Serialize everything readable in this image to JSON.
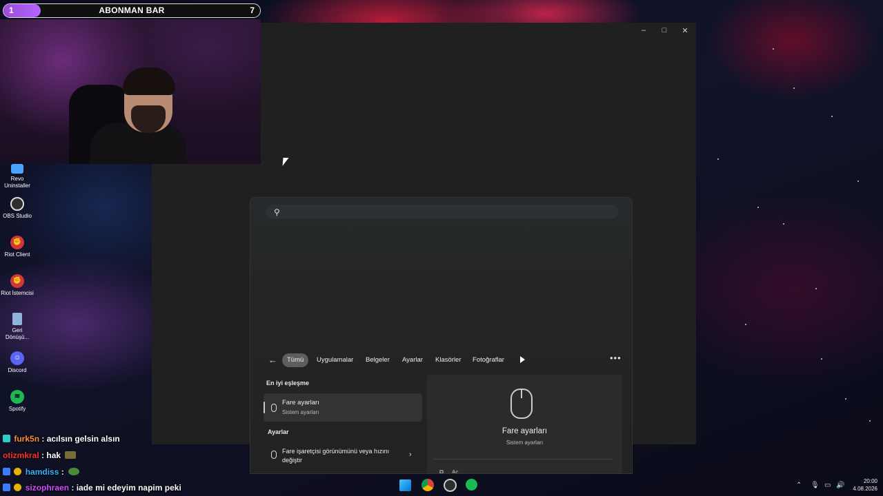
{
  "overlay": {
    "abonman_bar": {
      "left_value": "1",
      "title": "ABONMAN BAR",
      "right_value": "7",
      "progress_fraction": 0.14
    }
  },
  "window_controls": {
    "minimize": "–",
    "maximize": "□",
    "close": "✕"
  },
  "desktop_icons": [
    {
      "label": "Revo Uninstaller",
      "icon": "revo-uninstaller-icon",
      "color": "#4aa3ff"
    },
    {
      "label": "OBS Studio",
      "icon": "obs-studio-icon",
      "color": "#3a3a3a"
    },
    {
      "label": "Riot Client",
      "icon": "riot-client-icon",
      "color": "#d13639"
    },
    {
      "label": "Riot İstemcisi",
      "icon": "riot-client-icon",
      "color": "#d13639"
    },
    {
      "label": "Geri Dönüşü...",
      "icon": "recycle-bin-icon",
      "color": "#8fb3d9"
    },
    {
      "label": "Discord",
      "icon": "discord-icon",
      "color": "#5865f2"
    },
    {
      "label": "Spotify",
      "icon": "spotify-icon",
      "color": "#1db954"
    }
  ],
  "chat": [
    {
      "user": "furk5n",
      "message": ": acılsın gelsin alsın",
      "user_color": "#ff8c3a"
    },
    {
      "user": "otizmkral",
      "message": ": hak",
      "user_color": "#ff3030"
    },
    {
      "user": "hamdiss",
      "message": ":",
      "user_color": "#33b5ff"
    },
    {
      "user": "sizophraen",
      "message": ": iade mi edeyim napim peki",
      "user_color": "#d24dff"
    }
  ],
  "search_panel": {
    "search_placeholder": "",
    "filters": [
      "Tümü",
      "Uygulamalar",
      "Belgeler",
      "Ayarlar",
      "Klasörler",
      "Fotoğraflar"
    ],
    "active_filter": "Tümü",
    "best_match_title": "En iyi eşleşme",
    "best_match": {
      "title": "Fare ayarları",
      "subtitle": "Sistem ayarları"
    },
    "settings_title": "Ayarlar",
    "settings_item": "Fare işaretçisi görünümünü veya hızını değiştir",
    "preview": {
      "title": "Fare ayarları",
      "subtitle": "Sistem ayarları",
      "open_label": "Aç"
    }
  },
  "taskbar": {
    "apps": [
      "start-icon",
      "chrome-icon",
      "obs-icon",
      "spotify-icon"
    ],
    "time": "20:00",
    "date": "4.08.2026"
  }
}
